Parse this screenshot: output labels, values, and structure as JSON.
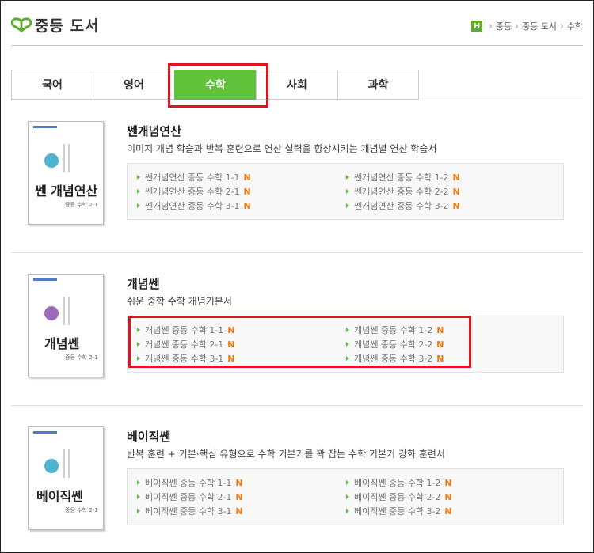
{
  "header": {
    "logo_text": "중등 도서",
    "home_badge": "H",
    "breadcrumb": [
      "중등",
      "중등 도서",
      "수학"
    ]
  },
  "tabs": [
    {
      "label": "국어",
      "active": false
    },
    {
      "label": "영어",
      "active": false
    },
    {
      "label": "수학",
      "active": true
    },
    {
      "label": "사회",
      "active": false
    },
    {
      "label": "과학",
      "active": false
    }
  ],
  "books": [
    {
      "title": "쎈개념연산",
      "desc": "이미지 개념 학습과 반복 훈련으로 연산 실력을 향상시키는 개념별 연산 학습서",
      "cover_title": "쎈 개념연산",
      "cover_sub": "중등 수학 2-1",
      "links": [
        "쎈개념연산 중등 수학 1-1",
        "쎈개념연산 중등 수학 1-2",
        "쎈개념연산 중등 수학 2-1",
        "쎈개념연산 중등 수학 2-2",
        "쎈개념연산 중등 수학 3-1",
        "쎈개념연산 중등 수학 3-2"
      ]
    },
    {
      "title": "개념쎈",
      "desc": "쉬운 중학 수학 개념기본서",
      "cover_title": "개념쎈",
      "cover_sub": "중등 수학 2-1",
      "links": [
        "개념쎈 중등 수학 1-1",
        "개념쎈 중등 수학 1-2",
        "개념쎈 중등 수학 2-1",
        "개념쎈 중등 수학 2-2",
        "개념쎈 중등 수학 3-1",
        "개념쎈 중등 수학 3-2"
      ]
    },
    {
      "title": "베이직쎈",
      "desc": "반복 훈련 + 기본·핵심 유형으로 수학 기본기를 꽉 잡는 수학 기본기 강화 훈련서",
      "cover_title": "베이직쎈",
      "cover_sub": "중등 수학 2-1",
      "links": [
        "베이직쎈 중등 수학 1-1",
        "베이직쎈 중등 수학 1-2",
        "베이직쎈 중등 수학 2-1",
        "베이직쎈 중등 수학 2-2",
        "베이직쎈 중등 수학 3-1",
        "베이직쎈 중등 수학 3-2"
      ]
    }
  ],
  "new_badge": "N",
  "colors": {
    "accent": "#5fc23a",
    "highlight": "#e0141e",
    "new": "#f07a10"
  }
}
